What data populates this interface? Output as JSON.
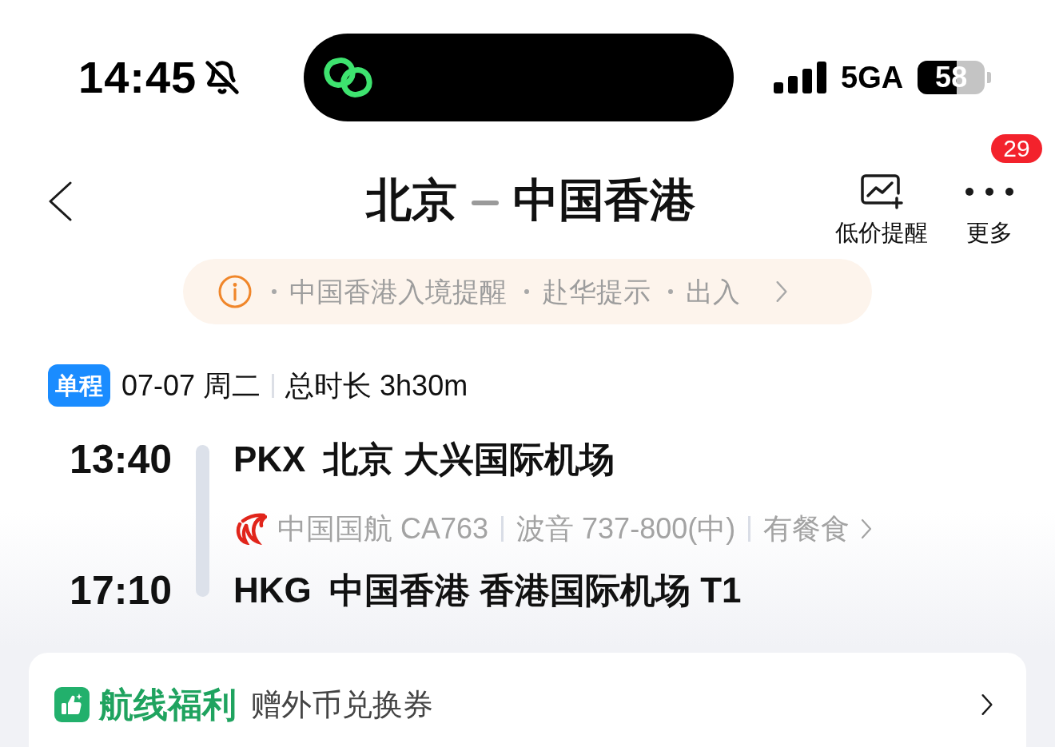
{
  "status_bar": {
    "time": "14:45",
    "silent": true,
    "network": "5GA",
    "battery": "58"
  },
  "header": {
    "origin": "北京",
    "destination": "中国香港",
    "actions": [
      {
        "kind": "price_alert",
        "label": "低价提醒"
      },
      {
        "kind": "more",
        "label": "更多",
        "badge": "29"
      }
    ]
  },
  "notice": {
    "items": [
      "中国香港入境提醒",
      "赴华提示",
      "出入"
    ]
  },
  "trip": {
    "type": "单程",
    "date": "07-07 周二",
    "duration": "总时长 3h30m"
  },
  "flight": {
    "departure": {
      "time": "13:40",
      "code": "PKX",
      "airport": "北京 大兴国际机场"
    },
    "details": [
      {
        "kind": "airline",
        "text": "中国国航 CA763"
      },
      {
        "kind": "aircraft",
        "text": "波音 737-800(中)"
      },
      {
        "kind": "meal",
        "text": "有餐食"
      }
    ],
    "arrival": {
      "time": "17:10",
      "code": "HKG",
      "airport": "中国香港 香港国际机场 T1"
    }
  },
  "benefit": {
    "title": "航线福利",
    "text": "赠外币兑换券"
  }
}
